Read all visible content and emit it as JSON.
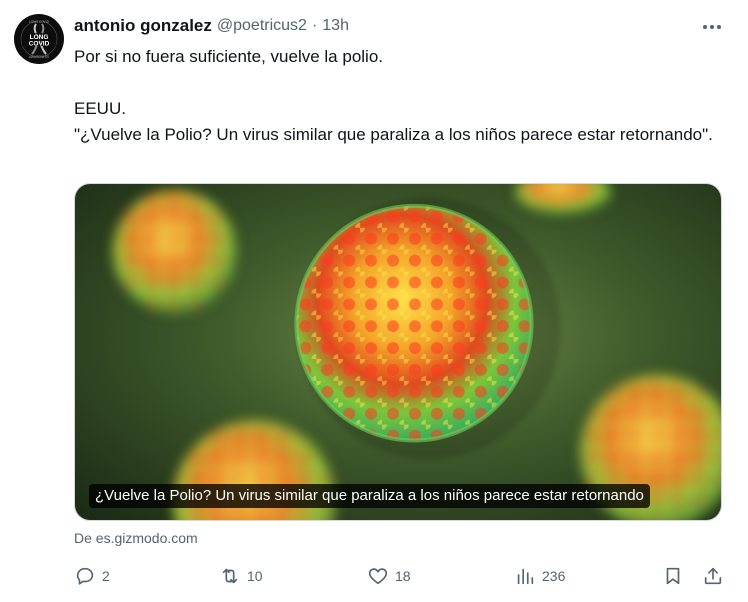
{
  "tweet": {
    "author_name": "antonio gonzalez",
    "author_handle": "@poetricus2",
    "separator": "·",
    "time": "13h",
    "avatar": {
      "top_text": "LONG COVID",
      "line1": "LONG",
      "line2": "COVID",
      "bottom_text": "AWARENESS"
    },
    "text_lines": [
      "Por si no fuera suficiente, vuelve la polio.",
      "EEUU.",
      "\"¿Vuelve la Polio? Un virus similar que paraliza a los niños parece estar retornando\"."
    ]
  },
  "card": {
    "title": "¿Vuelve la Polio? Un virus similar que paraliza a los niños parece estar retornando",
    "source": "De es.gizmodo.com"
  },
  "actions": {
    "replies": "2",
    "retweets": "10",
    "likes": "18",
    "views": "236"
  },
  "icons": {
    "more": "more-horizontal-icon",
    "reply": "reply-icon",
    "retweet": "retweet-icon",
    "like": "heart-icon",
    "views": "views-chart-icon",
    "bookmark": "bookmark-icon",
    "share": "share-icon"
  },
  "colors": {
    "text_primary": "#0f1419",
    "text_secondary": "#536471",
    "border": "#cfd9de"
  }
}
